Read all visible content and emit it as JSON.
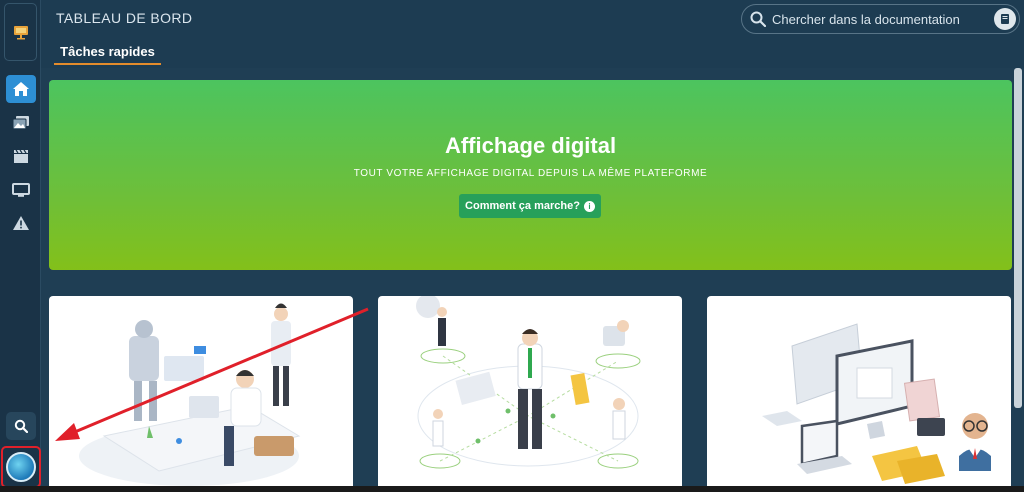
{
  "header": {
    "title": "TABLEAU DE BORD",
    "tab_label": "Tâches rapides",
    "search_placeholder": "Chercher dans la documentation"
  },
  "hero": {
    "title": "Affichage digital",
    "subtitle": "TOUT VOTRE AFFICHAGE DIGITAL DEPUIS LA MÊME PLATEFORME",
    "button_label": "Comment ça marche?",
    "info_glyph": "i"
  },
  "sidebar": {
    "items": [
      {
        "name": "home",
        "icon": "home-icon",
        "active": true
      },
      {
        "name": "media",
        "icon": "images-icon",
        "active": false
      },
      {
        "name": "playlists",
        "icon": "clapperboard-icon",
        "active": false
      },
      {
        "name": "screens",
        "icon": "monitor-icon",
        "active": false
      },
      {
        "name": "alerts",
        "icon": "warning-icon",
        "active": false
      }
    ],
    "collapse_glyph": "⇥"
  },
  "colors": {
    "background": "#1d3c52",
    "accent": "#2d8fd4",
    "tab_underline": "#e48c2c",
    "hero_green_top": "#4cc45f",
    "hero_green_bottom": "#83c01a",
    "hero_button": "#27a05a",
    "annotation": "#e0202a"
  },
  "cards": [
    {
      "name": "card-office-illustration"
    },
    {
      "name": "card-network-illustration"
    },
    {
      "name": "card-devices-illustration"
    }
  ]
}
